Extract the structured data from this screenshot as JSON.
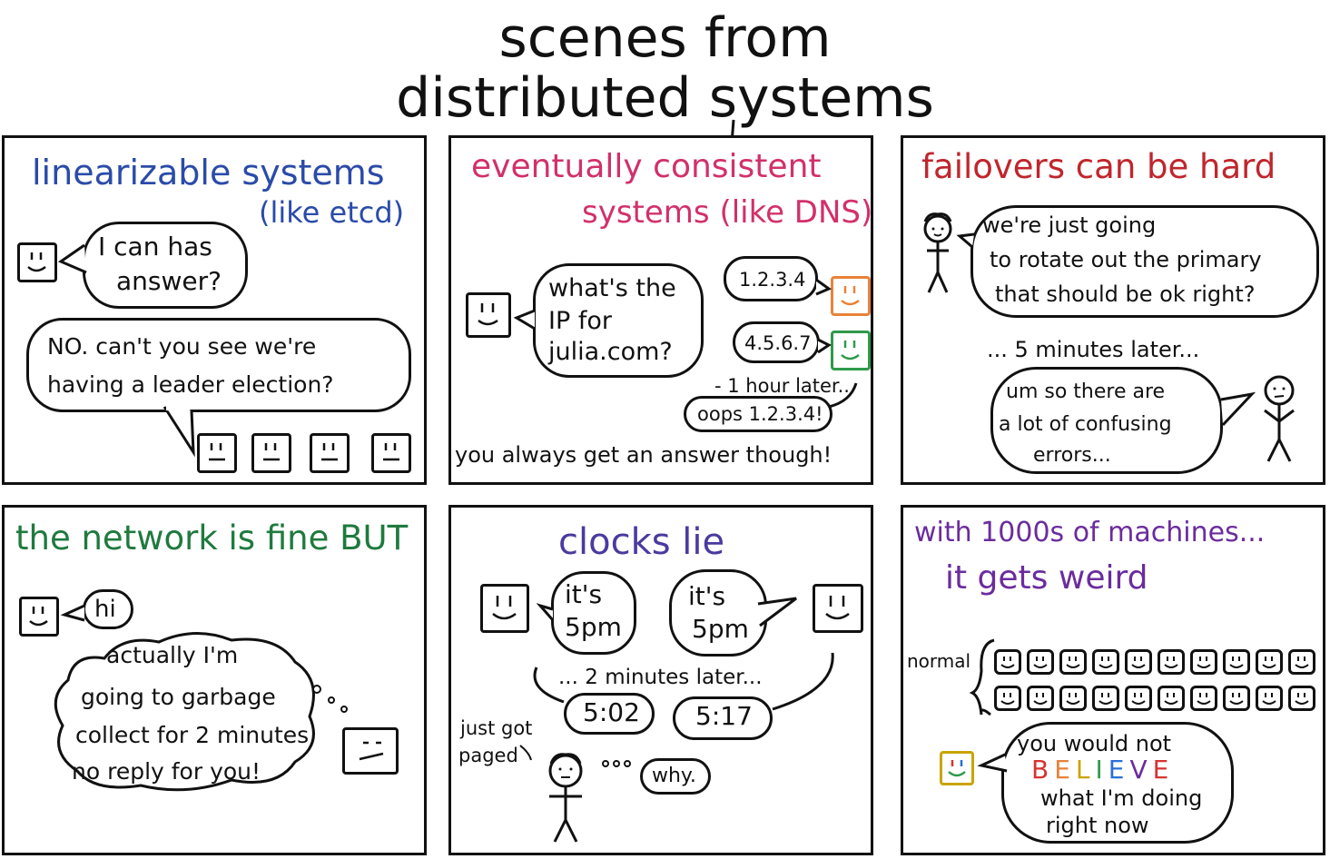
{
  "title": {
    "line1": "scenes from",
    "line2": "distributed systems"
  },
  "colors": {
    "ink": "#111111",
    "blue": "#2a4ba8",
    "pink": "#d2306b",
    "red": "#c0262c",
    "green": "#1f7a3e",
    "purple": "#4a3aa0",
    "violet": "#6b2c9e",
    "orange": "#e8823a",
    "green_face": "#2f9a4a"
  },
  "panels": {
    "linearizable": {
      "title": "linearizable systems",
      "subtitle": "(like etcd)",
      "question": [
        "I can has",
        "answer?"
      ],
      "reply": [
        "NO. can't you see we're",
        "having a leader election?"
      ]
    },
    "eventual": {
      "title": "eventually consistent",
      "subtitle": "systems (like DNS)",
      "question": [
        "what's the",
        "IP for",
        "julia.com?"
      ],
      "answer1": "1.2.3.4",
      "answer2": "4.5.6.7",
      "later": "- 1 hour later..",
      "oops": "oops 1.2.3.4!",
      "footer": "you always get an answer though!"
    },
    "failovers": {
      "title": "failovers can be hard",
      "speech": [
        "we're just going",
        "to rotate out the primary",
        "that should be ok right?"
      ],
      "later": "... 5 minutes later...",
      "reply": [
        "um so there are",
        "a lot of confusing",
        "errors..."
      ]
    },
    "network": {
      "title": "the network is fine BUT",
      "hi": "hi",
      "thought": [
        "actually I'm",
        "going to garbage",
        "collect for 2 minutes",
        "no reply for you!"
      ]
    },
    "clocks": {
      "title": "clocks lie",
      "left_bubble": [
        "it's",
        "5pm"
      ],
      "right_bubble": [
        "it's",
        "5pm"
      ],
      "later": "... 2 minutes later...",
      "time_left": "5:02",
      "time_right": "5:17",
      "paged": [
        "just got",
        "paged"
      ],
      "why": "why."
    },
    "thousands": {
      "title": "with 1000s of machines...",
      "subtitle": "it gets weird",
      "normal": "normal",
      "speech_line1": "you would not",
      "believe_letters": [
        {
          "ch": "B",
          "color": "#d6332f"
        },
        {
          "ch": "E",
          "color": "#e8823a"
        },
        {
          "ch": "L",
          "color": "#c9a400"
        },
        {
          "ch": "I",
          "color": "#2f9a4a"
        },
        {
          "ch": "E",
          "color": "#2a6fd6"
        },
        {
          "ch": "V",
          "color": "#6b2c9e"
        },
        {
          "ch": "E",
          "color": "#d6332f"
        }
      ],
      "speech_line3": "what I'm doing",
      "speech_line4": "right now"
    }
  }
}
